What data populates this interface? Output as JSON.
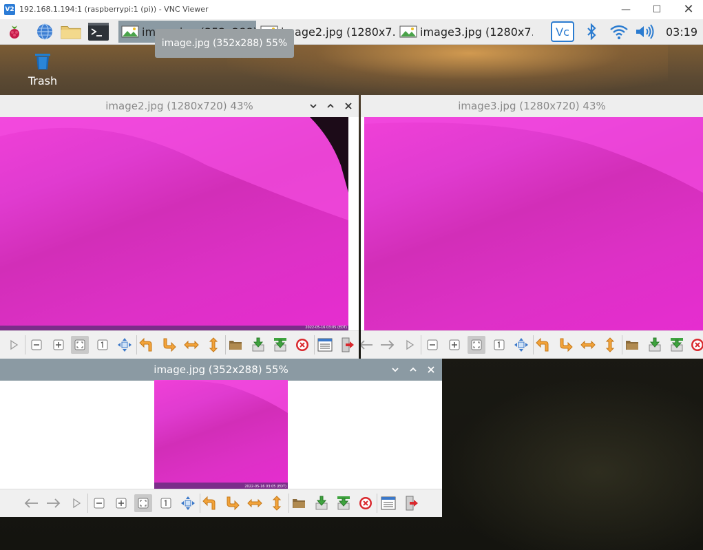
{
  "vnc": {
    "title": "192.168.1.194:1 (raspberrypi:1 (pi)) - VNC Viewer",
    "logo": "V2"
  },
  "taskbar": {
    "tasks": [
      {
        "label": "image.jpg (352x288) 55%",
        "active": true
      },
      {
        "label": "image2.jpg (1280x7…",
        "active": false
      },
      {
        "label": "image3.jpg (1280x7…",
        "active": false
      }
    ],
    "clock": "03:19",
    "tray_logo": "Vc"
  },
  "tooltip": "image.jpg (352x288) 55%",
  "desktop": {
    "trash_label": "Trash"
  },
  "windows": {
    "image2": {
      "title": "image2.jpg (1280x720) 43%",
      "stamp": "2022-05-16 03:05 (EDT)"
    },
    "image3": {
      "title": "image3.jpg (1280x720) 43%"
    },
    "image1": {
      "title": "image.jpg (352x288) 55%",
      "stamp": "2022-05-16 03:05 (EDT)"
    }
  },
  "colors": {
    "active_title": "#8b9aa3",
    "image_pink": "#e12bc8",
    "arrow_orange": "#f2a33a",
    "close_red": "#d9282d"
  },
  "icons": {
    "window_controls": [
      "chevron-down-icon",
      "chevron-up-icon",
      "close-icon"
    ],
    "toolbar": [
      "prev-icon",
      "next-icon",
      "play-icon",
      "zoom-out-icon",
      "zoom-in-icon",
      "fit-icon",
      "original-size-icon",
      "fullscreen-icon",
      "rotate-left-icon",
      "rotate-right-icon",
      "flip-horizontal-icon",
      "flip-vertical-icon",
      "open-icon",
      "save-icon",
      "save-as-icon",
      "delete-icon",
      "preferences-icon",
      "quit-icon"
    ]
  }
}
